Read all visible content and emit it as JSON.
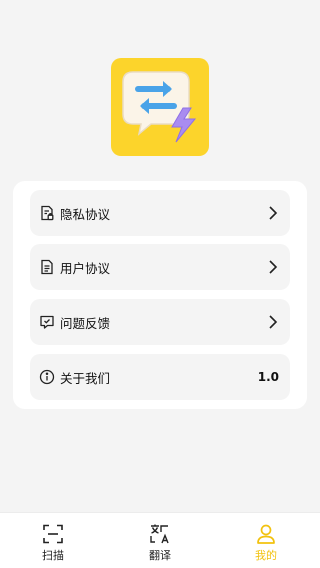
{
  "app": {
    "logo_icon": "chat-bubble-swap-lightning-icon",
    "logo_color": "#fcd42b"
  },
  "menu": {
    "items": [
      {
        "label": "隐私协议",
        "icon": "privacy-document-icon",
        "trailing": "chevron-right-icon"
      },
      {
        "label": "用户协议",
        "icon": "document-icon",
        "trailing": "chevron-right-icon"
      },
      {
        "label": "问题反馈",
        "icon": "feedback-message-icon",
        "trailing": "chevron-right-icon"
      },
      {
        "label": "关于我们",
        "icon": "info-icon",
        "value": "1.0"
      }
    ]
  },
  "tabbar": {
    "active_color": "#f2c20f",
    "tabs": [
      {
        "label": "扫描",
        "icon": "scan-icon",
        "active": false
      },
      {
        "label": "翻译",
        "icon": "translate-icon",
        "active": false
      },
      {
        "label": "我的",
        "icon": "user-icon",
        "active": true
      }
    ]
  }
}
